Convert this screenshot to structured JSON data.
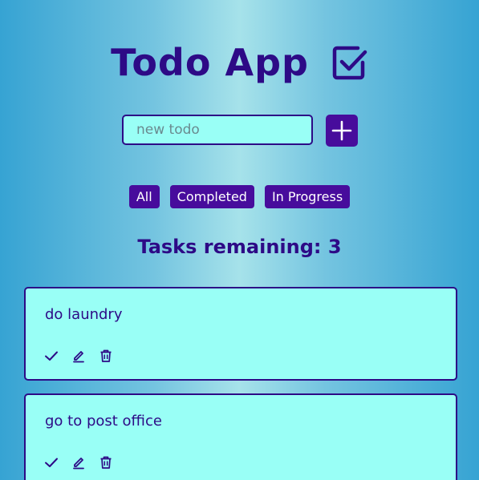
{
  "header": {
    "title": "Todo App",
    "title_icon": "checkbox-icon"
  },
  "add_form": {
    "placeholder": "new todo",
    "value": "",
    "add_button_icon": "plus-icon"
  },
  "filters": [
    {
      "label": "All"
    },
    {
      "label": "Completed"
    },
    {
      "label": "In Progress"
    }
  ],
  "status": {
    "remaining_text": "Tasks remaining: 3"
  },
  "todos": [
    {
      "text": "do laundry",
      "actions": [
        "check-icon",
        "edit-icon",
        "trash-icon"
      ]
    },
    {
      "text": "go to post office",
      "actions": [
        "check-icon",
        "edit-icon",
        "trash-icon"
      ]
    }
  ],
  "colors": {
    "primary": "#470c9c",
    "text": "#2d0a86",
    "card_bg": "#99fff6",
    "background_edge": "#36a3d3",
    "background_center": "#a6e2ea"
  }
}
